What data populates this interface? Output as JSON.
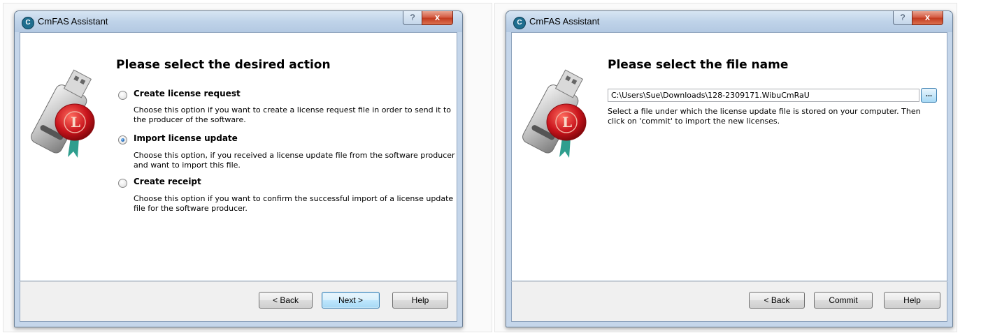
{
  "dialogs": [
    {
      "title": "CmFAS Assistant",
      "titlebar_help": "?",
      "titlebar_close": "x",
      "heading": "Please select the desired action",
      "options": [
        {
          "label": "Create license request",
          "description": "Choose this option if you want to create a license request file in order to send it to the producer of the software.",
          "checked": false
        },
        {
          "label": "Import license update",
          "description": "Choose this option, if you received a license update file from the software producer and want to import this file.",
          "checked": true
        },
        {
          "label": "Create receipt",
          "description": "Choose this option if you want to confirm the successful import of a license update file for the software producer.",
          "checked": false
        }
      ],
      "buttons": {
        "back": "< Back",
        "next": "Next >",
        "help": "Help"
      }
    },
    {
      "title": "CmFAS Assistant",
      "titlebar_help": "?",
      "titlebar_close": "x",
      "heading": "Please select the file name",
      "file_path": "C:\\Users\\Sue\\Downloads\\128-2309171.WibuCmRaU",
      "browse_label": "...",
      "description": "Select a file under which the license update file is stored on your computer. Then click on 'commit' to import the new licenses.",
      "buttons": {
        "back": "< Back",
        "commit": "Commit",
        "help": "Help"
      }
    }
  ],
  "icons": [
    "cmfas-app-icon",
    "usb-license-key-icon",
    "help-icon",
    "close-icon",
    "radio-button"
  ],
  "colors": {
    "titlebar": "#c5d6ea",
    "close_button": "#c9452a",
    "default_button_border": "#3c7fb1",
    "wax_seal": "#c8141c"
  }
}
